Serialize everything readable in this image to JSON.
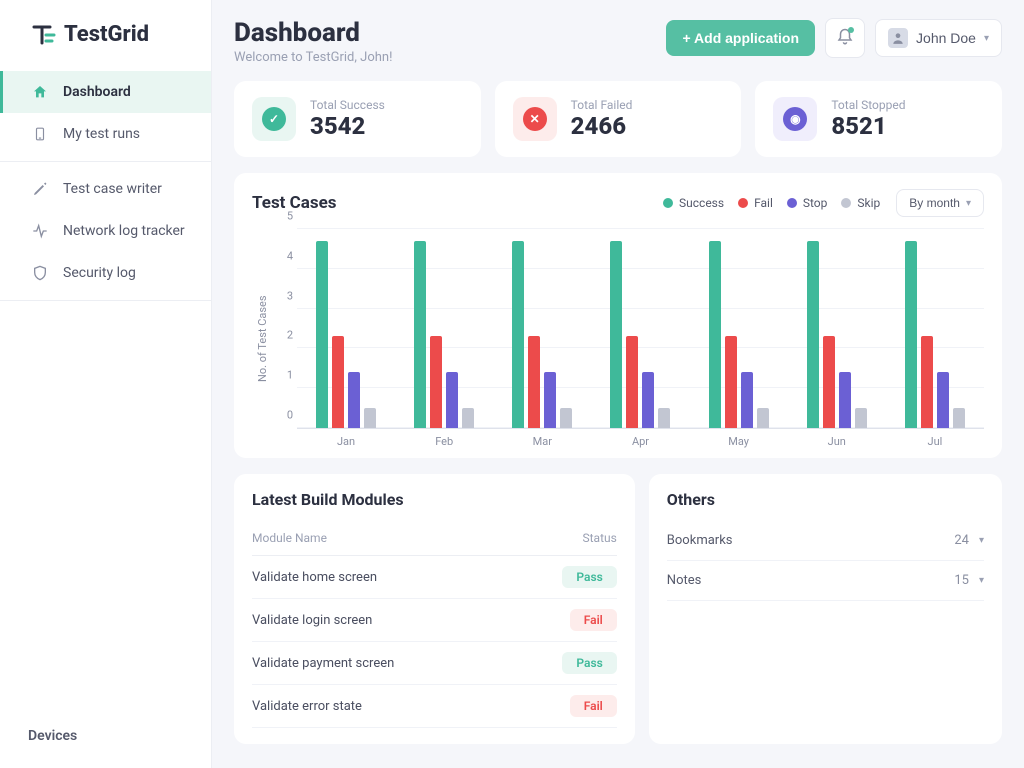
{
  "brand": {
    "name": "TestGrid"
  },
  "sidebar": {
    "primary": [
      {
        "label": "Dashboard",
        "active": true
      },
      {
        "label": "My test runs",
        "active": false
      }
    ],
    "secondary": [
      {
        "label": "Test case writer"
      },
      {
        "label": "Network log tracker"
      },
      {
        "label": "Security log"
      }
    ],
    "footer_label": "Devices"
  },
  "header": {
    "title": "Dashboard",
    "subtitle": "Welcome to TestGrid, John!",
    "add_button": "+ Add application",
    "user_name": "John Doe"
  },
  "stats": {
    "success": {
      "label": "Total Success",
      "value": "3542"
    },
    "failed": {
      "label": "Total Failed",
      "value": "2466"
    },
    "stopped": {
      "label": "Total Stopped",
      "value": "8521"
    }
  },
  "chart": {
    "title": "Test Cases",
    "ylabel": "No. of Test Cases",
    "legend": [
      "Success",
      "Fail",
      "Stop",
      "Skip"
    ],
    "colors": {
      "success": "#3fb99a",
      "fail": "#ec4b4b",
      "stop": "#6b60d4",
      "skip": "#c2c6d2"
    },
    "period_selector": "By month"
  },
  "chart_data": {
    "type": "bar",
    "ylabel": "No. of Test Cases",
    "xlabel": "",
    "ylim": [
      0,
      5
    ],
    "yticks": [
      0,
      1,
      2,
      3,
      4,
      5
    ],
    "categories": [
      "Jan",
      "Feb",
      "Mar",
      "Apr",
      "May",
      "Jun",
      "Jul"
    ],
    "series": [
      {
        "name": "Success",
        "color": "#3fb99a",
        "values": [
          4.7,
          4.7,
          4.7,
          4.7,
          4.7,
          4.7,
          4.7
        ]
      },
      {
        "name": "Fail",
        "color": "#ec4b4b",
        "values": [
          2.3,
          2.3,
          2.3,
          2.3,
          2.3,
          2.3,
          2.3
        ]
      },
      {
        "name": "Stop",
        "color": "#6b60d4",
        "values": [
          1.4,
          1.4,
          1.4,
          1.4,
          1.4,
          1.4,
          1.4
        ]
      },
      {
        "name": "Skip",
        "color": "#c2c6d2",
        "values": [
          0.5,
          0.5,
          0.5,
          0.5,
          0.5,
          0.5,
          0.5
        ]
      }
    ]
  },
  "modules": {
    "title": "Latest Build Modules",
    "columns": {
      "name": "Module Name",
      "status": "Status"
    },
    "rows": [
      {
        "name": "Validate home screen",
        "status": "Pass",
        "status_class": "pass"
      },
      {
        "name": "Validate login screen",
        "status": "Fail",
        "status_class": "fail"
      },
      {
        "name": "Validate payment screen",
        "status": "Pass",
        "status_class": "pass"
      },
      {
        "name": "Validate error state",
        "status": "Fail",
        "status_class": "fail"
      }
    ]
  },
  "others": {
    "title": "Others",
    "rows": [
      {
        "label": "Bookmarks",
        "count": "24"
      },
      {
        "label": "Notes",
        "count": "15"
      }
    ]
  }
}
